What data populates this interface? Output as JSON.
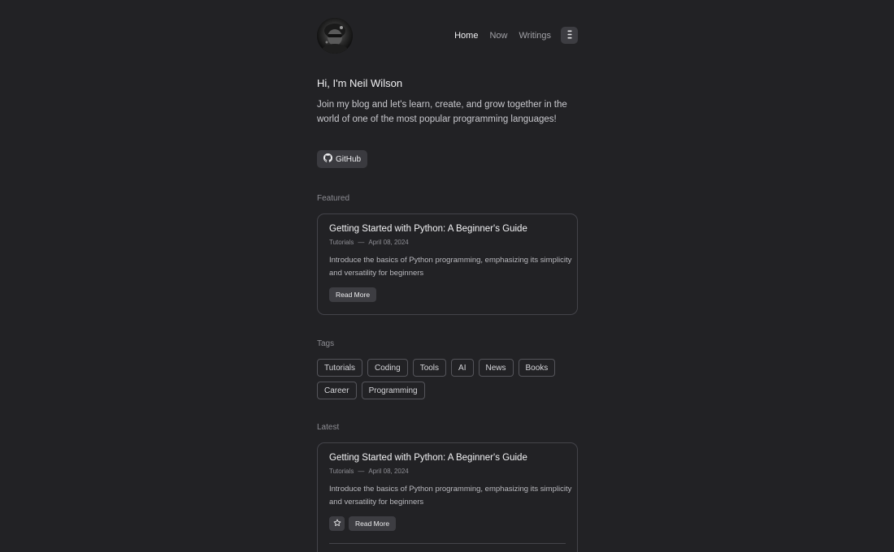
{
  "nav": {
    "items": [
      {
        "label": "Home",
        "active": true
      },
      {
        "label": "Now",
        "active": false
      },
      {
        "label": "Writings",
        "active": false
      }
    ],
    "menu_icon": "menu-dots-icon"
  },
  "intro": {
    "title": "Hi, I'm Neil Wilson",
    "text": "Join my blog and let's learn, create, and grow together in the world of one of the most popular programming languages!",
    "github_label": "GitHub"
  },
  "featured": {
    "label": "Featured",
    "post": {
      "title": "Getting Started with Python: A Beginner's Guide",
      "category": "Tutorials",
      "separator": "—",
      "date": "April 08, 2024",
      "description": "Introduce the basics of Python programming, emphasizing its simplicity and versatility for beginners",
      "read_more": "Read More"
    }
  },
  "tags": {
    "label": "Tags",
    "items": [
      "Tutorials",
      "Coding",
      "Tools",
      "AI",
      "News",
      "Books",
      "Career",
      "Programming"
    ]
  },
  "latest": {
    "label": "Latest",
    "post": {
      "title": "Getting Started with Python: A Beginner's Guide",
      "category": "Tutorials",
      "separator": "—",
      "date": "April 08, 2024",
      "description": "Introduce the basics of Python programming, emphasizing its simplicity and versatility for beginners",
      "read_more": "Read More"
    }
  },
  "colors": {
    "background": "#222225",
    "card_border": "#44444a",
    "button_bg": "#3d3d42"
  }
}
